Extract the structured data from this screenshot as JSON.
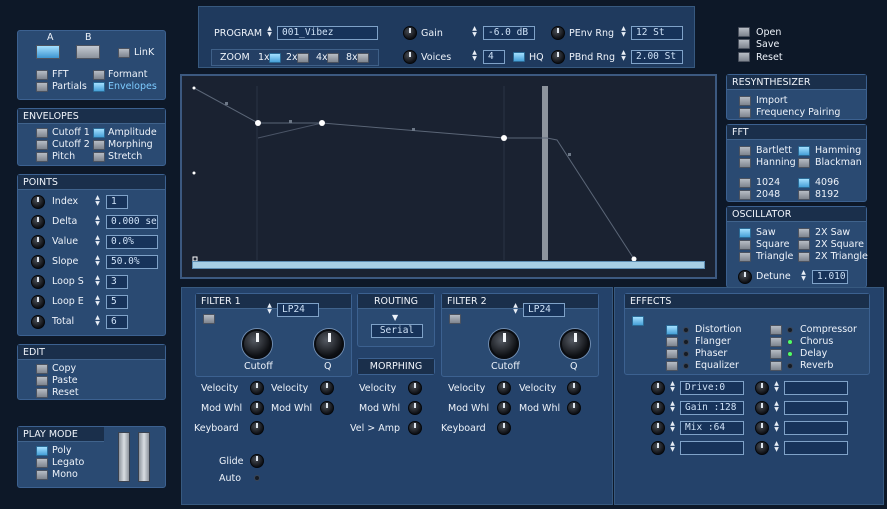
{
  "ab": {
    "a_label": "A",
    "b_label": "B",
    "link_label": "LinK"
  },
  "view_toggles": {
    "fft": "FFT",
    "formant": "Formant",
    "partials": "Partials",
    "envelopes": "Envelopes"
  },
  "envelopes": {
    "title": "ENVELOPES",
    "cutoff1": "Cutoff 1",
    "amplitude": "Amplitude",
    "cutoff2": "Cutoff 2",
    "morphing": "Morphing",
    "pitch": "Pitch",
    "stretch": "Stretch"
  },
  "points": {
    "title": "POINTS",
    "index_label": "Index",
    "index_value": "1",
    "delta_label": "Delta",
    "delta_value": "0.000 se",
    "value_label": "Value",
    "value_value": "0.0%",
    "slope_label": "Slope",
    "slope_value": "50.0%",
    "loops_label": "Loop S",
    "loops_value": "3",
    "loope_label": "Loop E",
    "loope_value": "5",
    "total_label": "Total",
    "total_value": "6"
  },
  "edit": {
    "title": "EDIT",
    "copy": "Copy",
    "paste": "Paste",
    "reset": "Reset"
  },
  "playmode": {
    "title": "PLAY MODE",
    "poly": "Poly",
    "legato": "Legato",
    "mono": "Mono"
  },
  "top": {
    "program_label": "PROGRAM",
    "program_value": "001_Vibez",
    "zoom_label": "ZOOM",
    "z1": "1x",
    "z2": "2x",
    "z4": "4x",
    "z8": "8x",
    "gain_label": "Gain",
    "gain_value": "-6.0 dB",
    "voices_label": "Voices",
    "voices_value": "4",
    "hq_label": "HQ",
    "penv_label": "PEnv Rng",
    "penv_value": "12 St",
    "pbnd_label": "PBnd Rng",
    "pbnd_value": "2.00 St"
  },
  "file": {
    "open": "Open",
    "save": "Save",
    "reset": "Reset"
  },
  "resynth": {
    "title": "RESYNTHESIZER",
    "import": "Import",
    "pairing": "Frequency Pairing"
  },
  "fft": {
    "title": "FFT",
    "bartlett": "Bartlett",
    "hamming": "Hamming",
    "hanning": "Hanning",
    "blackman": "Blackman",
    "s1024": "1024",
    "s4096": "4096",
    "s2048": "2048",
    "s8192": "8192"
  },
  "osc": {
    "title": "OSCILLATOR",
    "saw": "Saw",
    "saw2": "2X Saw",
    "square": "Square",
    "square2": "2X Square",
    "triangle": "Triangle",
    "triangle2": "2X Triangle",
    "detune_label": "Detune",
    "detune_value": "1.010"
  },
  "filter1": {
    "title": "FILTER 1",
    "type": "LP24",
    "cutoff": "Cutoff",
    "q": "Q",
    "velocity": "Velocity",
    "velocity2": "Velocity",
    "modwhl": "Mod Whl",
    "modwhl2": "Mod Whl",
    "keyboard": "Keyboard",
    "glide": "Glide",
    "auto": "Auto"
  },
  "routing": {
    "title": "ROUTING",
    "value": "Serial"
  },
  "morphing": {
    "title": "MORPHING",
    "velocity": "Velocity",
    "modwhl": "Mod Whl",
    "velamp": "Vel > Amp"
  },
  "filter2": {
    "title": "FILTER 2",
    "type": "LP24",
    "cutoff": "Cutoff",
    "q": "Q",
    "velocity": "Velocity",
    "velocity2": "Velocity",
    "modwhl": "Mod Whl",
    "modwhl2": "Mod Whl",
    "keyboard": "Keyboard"
  },
  "effects": {
    "title": "EFFECTS",
    "distortion": "Distortion",
    "compressor": "Compressor",
    "flanger": "Flanger",
    "chorus": "Chorus",
    "phaser": "Phaser",
    "delay": "Delay",
    "equalizer": "Equalizer",
    "reverb": "Reverb",
    "param1": "Drive:0",
    "param2": "Gain :128",
    "param3": "Mix  :64",
    "param4": ""
  },
  "colors": {
    "panel": "#2a4a72",
    "header": "#1a2f4b",
    "field": "#17335a",
    "accent": "#5ab8ee",
    "led_on": "#4cff6a",
    "display_bg": "#1a2231"
  }
}
